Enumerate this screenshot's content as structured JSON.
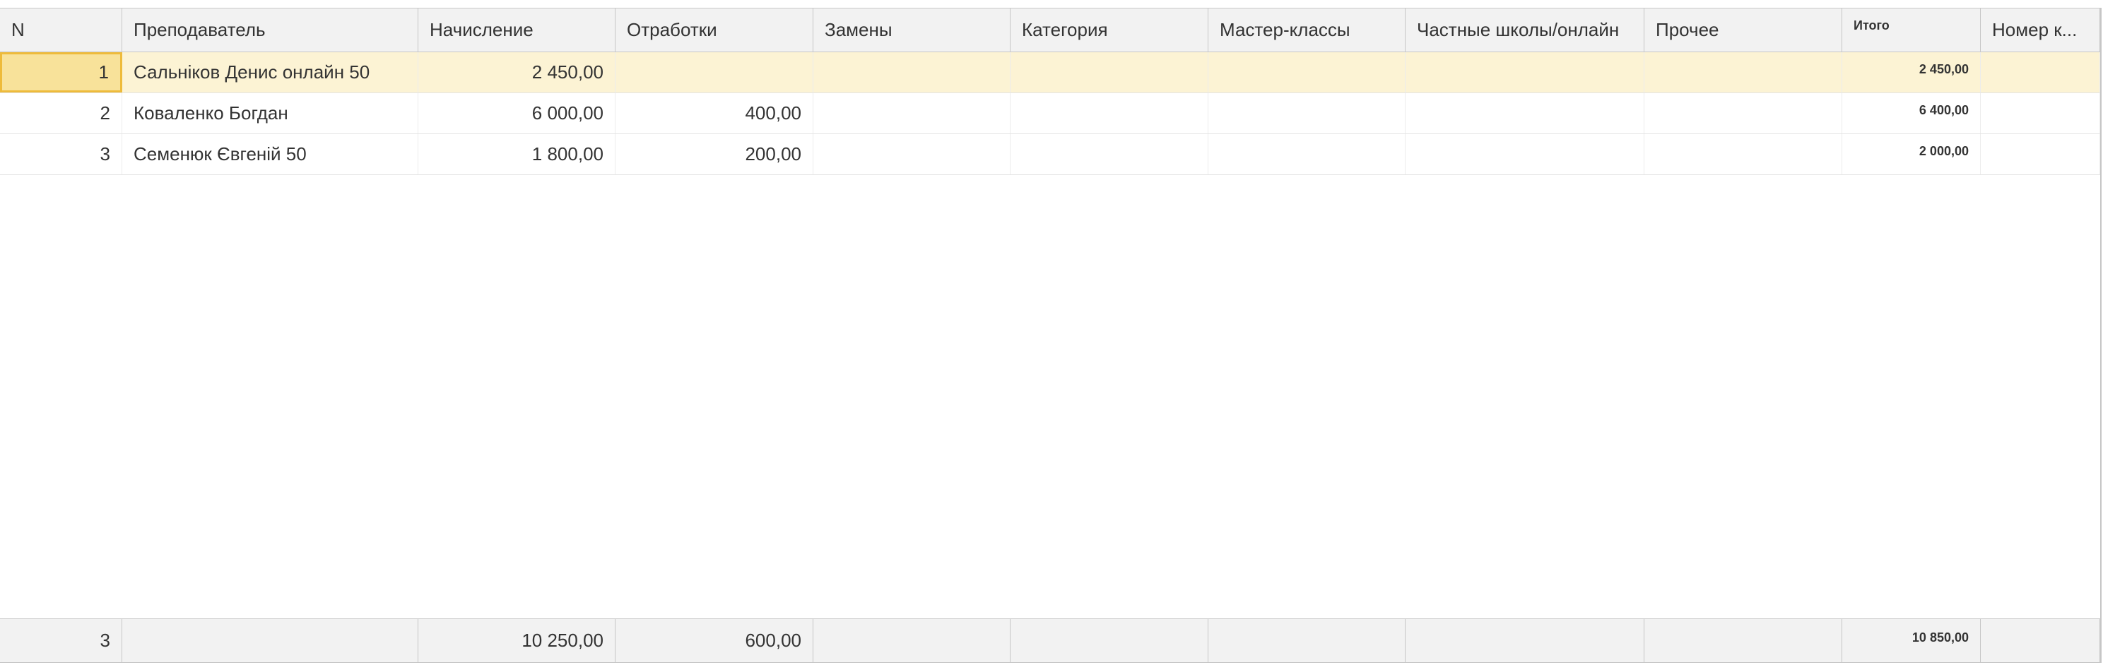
{
  "table": {
    "columns": [
      "N",
      "Преподаватель",
      "Начисление",
      "Отработки",
      "Замены",
      "Категория",
      "Мастер-классы",
      "Частные школы/онлайн",
      "Прочее",
      "Итого",
      "Номер к..."
    ],
    "rows": [
      {
        "n": "1",
        "teacher": "Сальніков Денис онлайн 50",
        "accrual": "2 450,00",
        "workoffs": "",
        "substitutions": "",
        "category": "",
        "masterclasses": "",
        "private_schools": "",
        "other": "",
        "total": "2 450,00",
        "number": ""
      },
      {
        "n": "2",
        "teacher": "Коваленко Богдан",
        "accrual": "6 000,00",
        "workoffs": "400,00",
        "substitutions": "",
        "category": "",
        "masterclasses": "",
        "private_schools": "",
        "other": "",
        "total": "6 400,00",
        "number": ""
      },
      {
        "n": "3",
        "teacher": "Семенюк Євгеній 50",
        "accrual": "1 800,00",
        "workoffs": "200,00",
        "substitutions": "",
        "category": "",
        "masterclasses": "",
        "private_schools": "",
        "other": "",
        "total": "2 000,00",
        "number": ""
      }
    ],
    "footer": {
      "n": "3",
      "teacher": "",
      "accrual": "10 250,00",
      "workoffs": "600,00",
      "substitutions": "",
      "category": "",
      "masterclasses": "",
      "private_schools": "",
      "other": "",
      "total": "10 850,00",
      "number": ""
    },
    "selected_row": 1,
    "colors": {
      "selected_row_bg": "#fcf3d4",
      "focused_cell_bg": "#f8e29a",
      "focused_cell_border": "#eebb3b",
      "header_bg": "#f2f2f2"
    }
  }
}
